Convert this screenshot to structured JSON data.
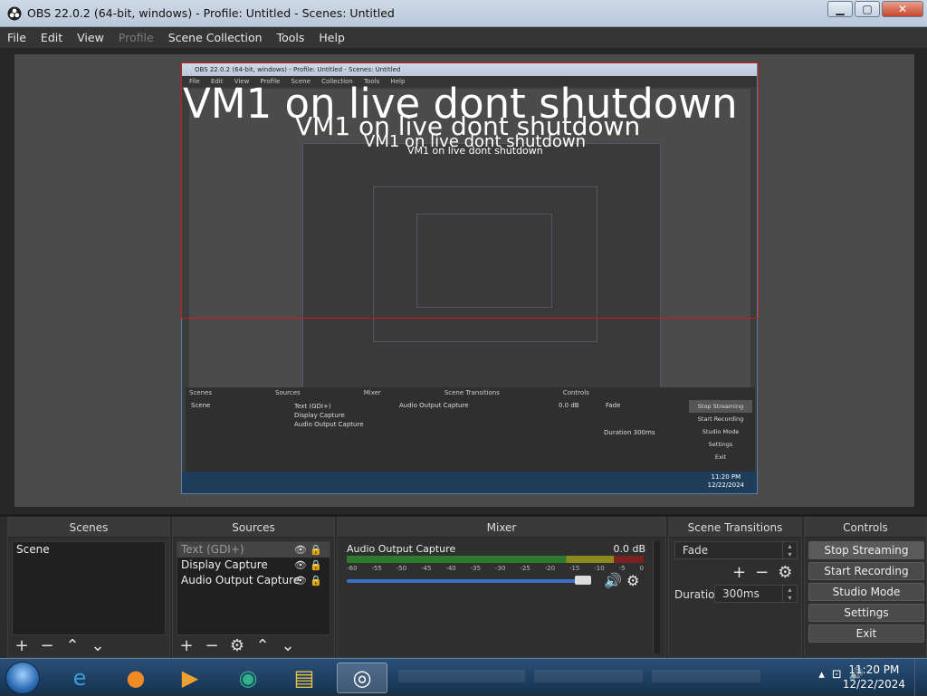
{
  "window": {
    "title": "OBS 22.0.2 (64-bit, windows) - Profile: Untitled - Scenes: Untitled",
    "minimize": "▁",
    "maximize": "▢",
    "close": "✕"
  },
  "menu": {
    "items": [
      {
        "label": "File",
        "enabled": true
      },
      {
        "label": "Edit",
        "enabled": true
      },
      {
        "label": "View",
        "enabled": true
      },
      {
        "label": "Profile",
        "enabled": false
      },
      {
        "label": "Scene Collection",
        "enabled": true
      },
      {
        "label": "Tools",
        "enabled": true
      },
      {
        "label": "Help",
        "enabled": true
      }
    ]
  },
  "preview": {
    "overlay_text": "VM1 on live dont shutdown",
    "nested": {
      "title": "OBS 22.0.2 (64-bit, windows) - Profile: Untitled - Scenes: Untitled",
      "menu": "File Edit View Profile Scene Collection Tools Help",
      "docks": [
        "Scenes",
        "Sources",
        "Mixer",
        "Scene Transitions",
        "Controls"
      ],
      "scene": "Scene",
      "sources": [
        "Text (GDI+)",
        "Display Capture",
        "Audio Output Capture"
      ],
      "mixer_name": "Audio Output Capture",
      "mixer_db": "0.0 dB",
      "transition": "Fade",
      "duration_label": "Duration",
      "duration_value": "300ms",
      "controls": [
        "Stop Streaming",
        "Start Recording",
        "Studio Mode",
        "Settings",
        "Exit"
      ],
      "time": "11:20 PM",
      "date": "12/22/2024"
    }
  },
  "docks": {
    "scenes": {
      "title": "Scenes",
      "items": [
        "Scene"
      ]
    },
    "sources": {
      "title": "Sources",
      "items": [
        {
          "label": "Text (GDI+)",
          "selected": true
        },
        {
          "label": "Display Capture",
          "selected": false
        },
        {
          "label": "Audio Output Capture",
          "selected": false
        }
      ]
    },
    "mixer": {
      "title": "Mixer",
      "channel": "Audio Output Capture",
      "level": "0.0 dB",
      "ticks": [
        "-60",
        "-55",
        "-50",
        "-45",
        "-40",
        "-35",
        "-30",
        "-25",
        "-20",
        "-15",
        "-10",
        "-5",
        "0"
      ]
    },
    "transitions": {
      "title": "Scene Transitions",
      "selected": "Fade",
      "duration_label": "Duration",
      "duration_value": "300ms"
    },
    "controls": {
      "title": "Controls",
      "buttons": [
        "Stop Streaming",
        "Start Recording",
        "Studio Mode",
        "Settings",
        "Exit"
      ]
    }
  },
  "taskbar": {
    "time": "11:20 PM",
    "date": "12/22/2024",
    "apps": [
      "internet-explorer-icon",
      "firefox-icon",
      "media-player-icon",
      "chat-icon",
      "file-explorer-icon",
      "obs-icon"
    ]
  }
}
